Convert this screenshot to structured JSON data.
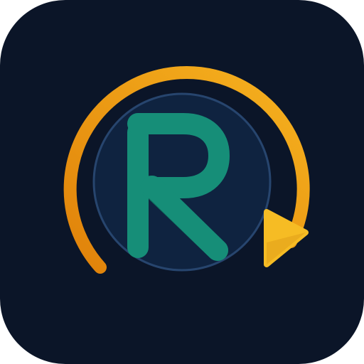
{
  "icon": {
    "name": "app-icon",
    "glyph": "R",
    "symbol": "refresh-arrow-icon",
    "colors": {
      "background": "#0b1528",
      "inner_circle_fill": "#0f2340",
      "inner_circle_stroke": "#27456e",
      "letter": "#168e78",
      "letter_shadow": "#0f6f5f",
      "arc_start": "#e0820a",
      "arc_end": "#f6b21f",
      "arrow_head": "#f6bc24",
      "arrow_head_shadow": "#e3a21a"
    }
  }
}
